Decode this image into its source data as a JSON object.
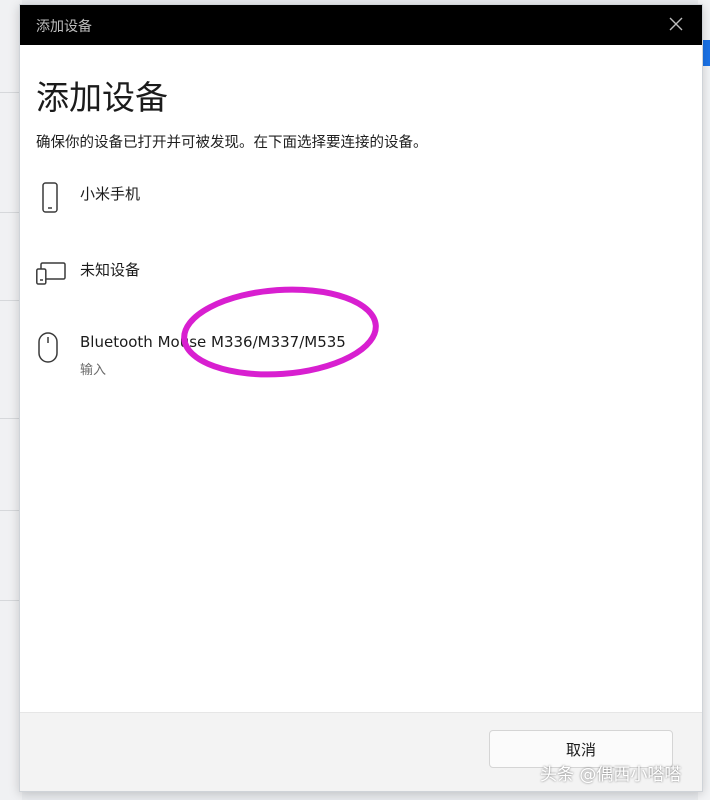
{
  "window": {
    "title": "添加设备"
  },
  "dialog": {
    "heading": "添加设备",
    "instruction": "确保你的设备已打开并可被发现。在下面选择要连接的设备。",
    "devices": [
      {
        "name": "小米手机",
        "icon": "phone-icon"
      },
      {
        "name": "未知设备",
        "icon": "unknown-device-icon"
      },
      {
        "name": "Bluetooth Mouse M336/M337/M535",
        "subtitle": "输入",
        "icon": "mouse-icon"
      }
    ],
    "cancel_label": "取消"
  },
  "annotation": {
    "color": "#d81fd0",
    "shape": "ellipse"
  },
  "watermark": "头条 @偶西小嗒嗒",
  "colors": {
    "titlebar": "#000000",
    "background": "#ffffff",
    "footer": "#f3f3f3"
  }
}
